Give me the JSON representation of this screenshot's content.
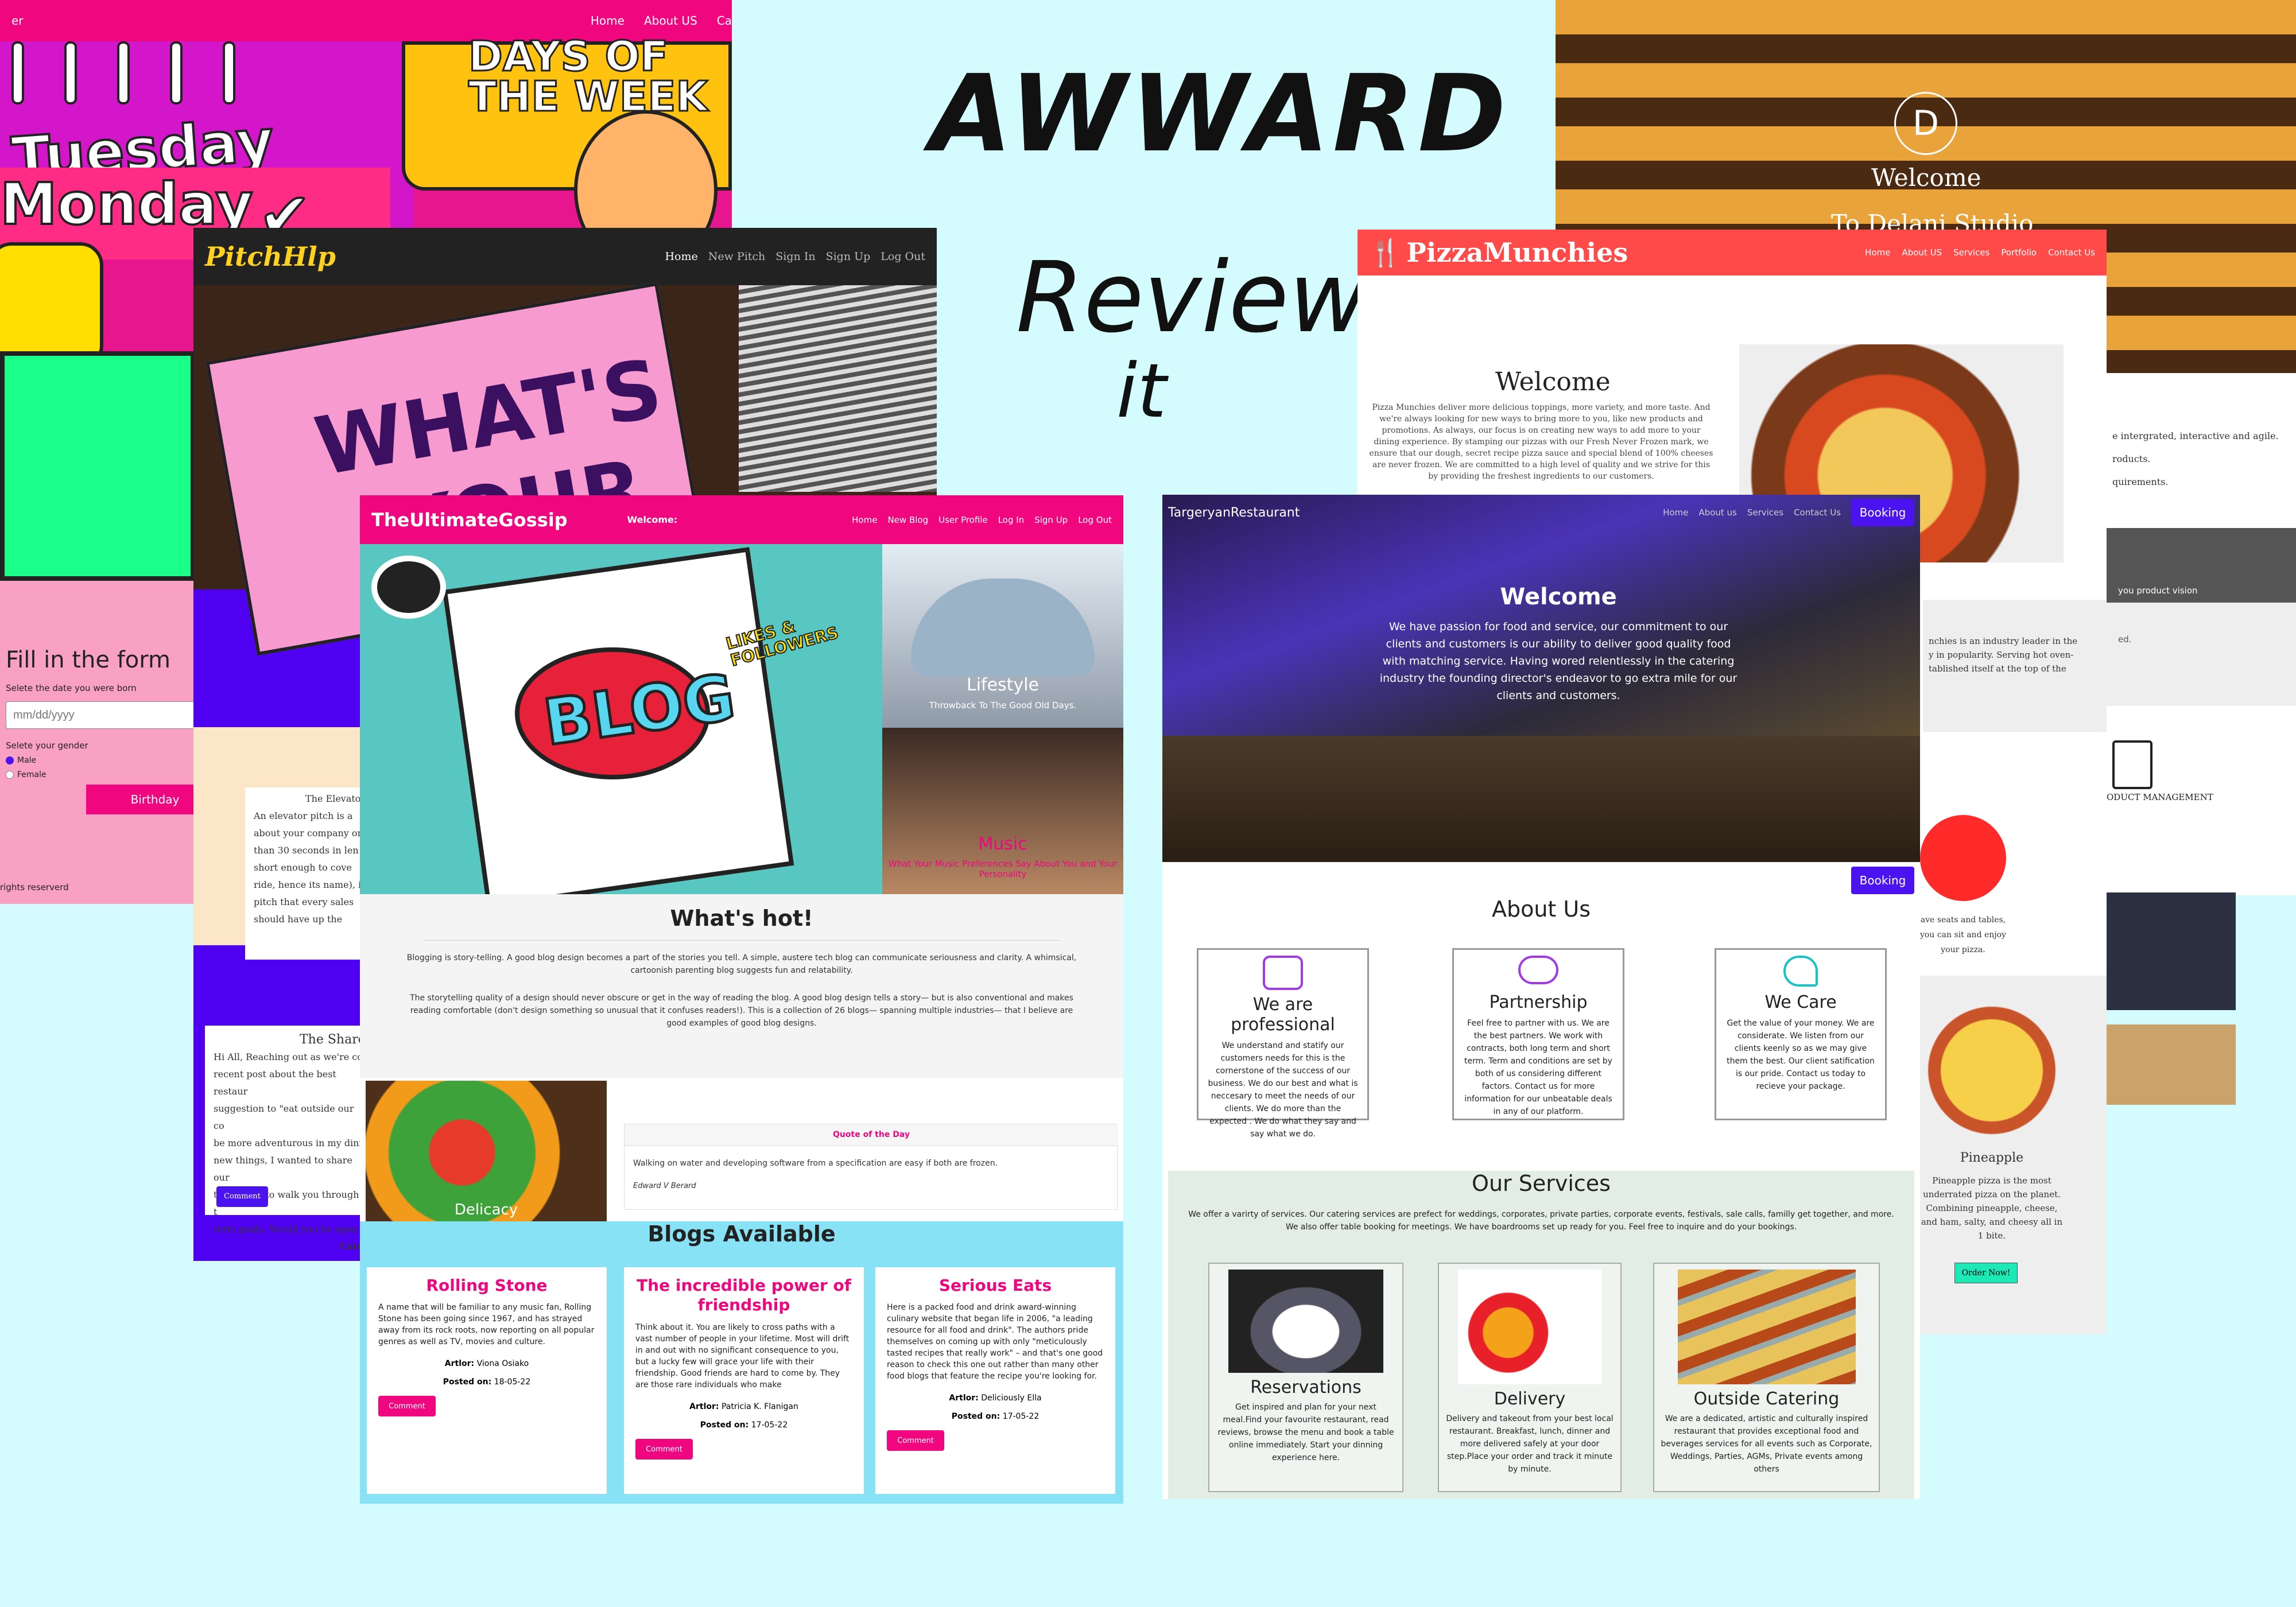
{
  "hero": {
    "title": "AWWARD",
    "subtitle": "Review",
    "subtitle2": "it"
  },
  "days": {
    "nav_left": "er",
    "nav_links": [
      "Home",
      "About US",
      "Ca"
    ],
    "banner_top": "DAYS OF",
    "banner_bottom": "THE WEEK",
    "tuesday": "Tuesday",
    "monday": "Monday",
    "form_title": "Fill in the form",
    "date_label": "Selete the date you were born",
    "date_placeholder": "mm/dd/yyyy",
    "gender_label": "Selete your gender",
    "gender_male": "Male",
    "gender_female": "Female",
    "birthday_btn": "Birthday",
    "footer": "rights reserverd"
  },
  "pitch": {
    "logo": "PitchHlp",
    "nav_links": [
      "Home",
      "New Pitch",
      "Sign In",
      "Sign Up",
      "Log Out"
    ],
    "hero_text_line1": "WHAT'S",
    "hero_text_line2": "YOUR",
    "elevator_title": "The Elevato",
    "elevator_body": [
      "An elevator pitch is a",
      "about your company or",
      "than 30 seconds in len",
      "short enough to cove",
      "ride, hence its name), i",
      "pitch that every sales",
      "should have up the"
    ],
    "share_title": "The Share",
    "share_body": [
      "Hi All, Reaching out as we're co",
      "recent post about the best restaur",
      "suggestion to \"eat outside our co",
      "be more adventurous in my dinn",
      "new things, I wanted to share our",
      "to connect to walk you through t",
      "term goals. Would you be open t"
    ],
    "share_cat": "Cate",
    "comment_btn": "Comment"
  },
  "delani": {
    "logo_letter": "D",
    "welcome": "Welcome",
    "to_studio": "To Delani Studio",
    "side_text1": [
      "e intergrated, interactive and agile.",
      "",
      "roducts.",
      "",
      "quirements."
    ],
    "side_text2": "you product vision",
    "side_text3": "ed.",
    "pm_label": "ODUCT MANAGEMENT"
  },
  "pizza": {
    "logo": "PizzaMunchies",
    "nav_links": [
      "Home",
      "About US",
      "Services",
      "Portfolio",
      "Contact Us"
    ],
    "welcome": "Welcome",
    "welcome_body": "Pizza Munchies deliver more delicious toppings, more variety, and more taste. And we're always looking for new ways to bring more to you, like new products and promotions. As always, our focus is on creating new ways to add more to your dining experience. By stamping our pizzas with our Fresh Never Frozen mark, we ensure that our dough, secret recipe pizza sauce and special blend of 100% cheeses are never frozen. We are committed to a high level of quality and we strive for this by providing the freshest ingredients to our customers.",
    "industry_text": [
      "nchies is an industry leader in the",
      "y in popularity. Serving hot oven-",
      "tablished itself at the top of the"
    ],
    "seats_text": [
      "ave seats and tables,",
      "you can sit and enjoy",
      "your pizza."
    ],
    "pineapple_title": "Pineapple",
    "pineapple_body": [
      "Pineapple pizza is the most",
      "underrated pizza on the planet.",
      "Combining pineapple, cheese,",
      "and ham, salty, and cheesy all in",
      "1 bite."
    ],
    "order_btn": "Order Now!"
  },
  "gossip": {
    "logo": "TheUltimateGossip",
    "welcome": "Welcome:",
    "nav_links": [
      "Home",
      "New Blog",
      "User Profile",
      "Log In",
      "Sign Up",
      "Log Out"
    ],
    "blog_word": "BLOG",
    "likes_word": "LIKES & FOLLOWERS",
    "lifestyle_title": "Lifestyle",
    "lifestyle_sub": "Throwback To The Good Old Days.",
    "music_title": "Music",
    "music_sub": "What Your Music Preferences Say About You and Your Personality",
    "whats_hot": "What's hot!",
    "hot_p1": "Blogging is story-telling. A good blog design becomes a part of the stories you tell. A simple, austere tech blog can communicate seriousness and clarity. A whimsical, cartoonish parenting blog suggests fun and relatability.",
    "hot_p2": "The storytelling quality of a design should never obscure or get in the way of reading the blog. A good blog design tells a story— but is also conventional and makes reading comfortable (don't design something so unusual that it confuses readers!). This is a collection of 26 blogs— spanning multiple industries— that I believe are good examples of good blog designs.",
    "delicacy": "Delicacy",
    "quote_title": "Quote of the Day",
    "quote_text": "Walking on water and developing software from a specification are easy if both are frozen.",
    "quote_author": "Edward V Berard",
    "blogs_title": "Blogs Available",
    "blogs": [
      {
        "title": "Rolling Stone",
        "body": "A name that will be familiar to any music fan, Rolling Stone has been going since 1967, and has strayed away from its rock roots, now reporting on all popular genres as well as TV, movies and culture.",
        "author_label": "Artlor:",
        "author": "Viona Osiako",
        "posted_label": "Posted on:",
        "posted": "18-05-22",
        "btn": "Comment"
      },
      {
        "title": "The incredible power of friendship",
        "body": "Think about it. You are likely to cross paths with a vast number of people in your lifetime. Most will drift in and out with no significant consequence to you, but a lucky few will grace your life with their friendship. Good friends are hard to come by. They are those rare individuals who make",
        "author_label": "Artlor:",
        "author": "Patricia K. Flanigan",
        "posted_label": "Posted on:",
        "posted": "17-05-22",
        "btn": "Comment"
      },
      {
        "title": "Serious Eats",
        "body": "Here is a packed food and drink award-winning culinary website that began life in 2006, \"a leading resource for all food and drink\". The authors pride themselves on coming up with only \"meticulously tasted recipes that really work\" – and that's one good reason to check this one out rather than many other food blogs that feature the recipe you're looking for.",
        "author_label": "Artlor:",
        "author": "Deliciously Ella",
        "posted_label": "Posted on:",
        "posted": "17-05-22",
        "btn": "Comment"
      }
    ]
  },
  "targeryan": {
    "logo": "TargeryanRestaurant",
    "nav_links": [
      "Home",
      "About us",
      "Services",
      "Contact Us"
    ],
    "booking_btn": "Booking",
    "welcome": "Welcome",
    "welcome_body": "We have passion for food and service, our commitment to our clients and customers is our ability to deliver good quality food with matching service. Having wored relentlessly in the catering industry the founding director's endeavor to go extra mile for our clients and customers.",
    "booking_btn2": "Booking",
    "about_title": "About Us",
    "about_cards": [
      {
        "title": "We are professional",
        "body": "We understand and statify our customers needs for this is the cornerstone of the success of our business. We do our best and what is neccesary to meet the needs of our clients. We do more than the expected . We do what they say and say what we do."
      },
      {
        "title": "Partnership",
        "body": "Feel free to partner with us. We are the best partners. We work with contracts, both long term and short term. Term and conditions are set by both of us considering different factors. Contact us for more information for our unbeatable deals in any of our platform."
      },
      {
        "title": "We Care",
        "body": "Get the value of your money. We are considerate. We listen from our clients keenly so as we may give them the best. Our client satification is our pride. Contact us today to recieve your package."
      }
    ],
    "services_title": "Our Services",
    "services_body": "We offer a varirty of services. Our catering services are prefect for weddings, corporates, private parties, corporate events, festivals, sale calls, familly get together, and more. We also offer table booking for meetings. We have boardrooms set up ready for you. Feel free to inquire and do your bookings.",
    "services": [
      {
        "title": "Reservations",
        "body": "Get inspired and plan for your next meal.Find your favourite restaurant, read reviews, browse the menu and book a table online immediately. Start your dinning experience here."
      },
      {
        "title": "Delivery",
        "body": "Delivery and takeout from your best local restaurant. Breakfast, lunch, dinner and more delivered safely at your door step.Place your order and track it minute by minute."
      },
      {
        "title": "Outside Catering",
        "body": "We are a dedicated, artistic and culturally inspired restaurant that provides exceptional food and beverages services for all events such as Corporate, Weddings, Parties, AGMs, Private events among others"
      }
    ]
  },
  "colors": {
    "pink": "#f0067f",
    "violet": "#4b13f0",
    "pizza_red": "#ff4a4a",
    "cyan_bg": "#d4fbfd",
    "sky": "#87e2f5"
  }
}
